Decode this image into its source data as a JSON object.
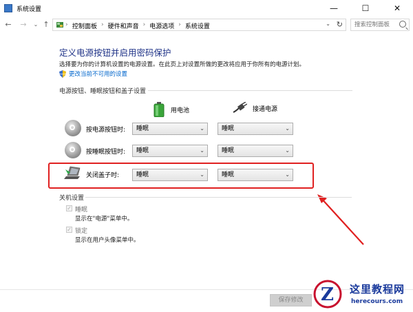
{
  "window": {
    "title": "系统设置",
    "controls": {
      "minimize": "—",
      "maximize": "☐",
      "close": "✕"
    }
  },
  "nav": {
    "back": "←",
    "forward": "→",
    "recent": "⌄",
    "up": "↑"
  },
  "address": {
    "crumbs": [
      "控制面板",
      "硬件和声音",
      "电源选项",
      "系统设置"
    ],
    "separator": "›",
    "dropdown": "⌄",
    "refresh": "↻"
  },
  "search": {
    "placeholder": "搜索控制面板"
  },
  "header": {
    "title": "定义电源按钮并启用密码保护",
    "description": "选择要为你的计算机设置的电源设置。在此页上对设置所做的更改将应用于你所有的电源计划。",
    "change_link": "更改当前不可用的设置"
  },
  "power_section": {
    "title": "电源按钮、睡眠按钮和盖子设置",
    "col_battery": "用电池",
    "col_plugged": "接通电源",
    "rows": [
      {
        "label": "按电源按钮时:",
        "battery": "睡眠",
        "plugged": "睡眠"
      },
      {
        "label": "按睡眠按钮时:",
        "battery": "睡眠",
        "plugged": "睡眠"
      },
      {
        "label": "关闭盖子时:",
        "battery": "睡眠",
        "plugged": "睡眠"
      }
    ],
    "chevron": "⌄"
  },
  "shutdown_section": {
    "title": "关机设置",
    "items": [
      {
        "label": "睡眠",
        "sub": "显示在\"电源\"菜单中。",
        "checked": true
      },
      {
        "label": "锁定",
        "sub": "显示在用户头像菜单中。",
        "checked": true
      }
    ],
    "checkmark": "✓"
  },
  "footer": {
    "save": "保存修改"
  },
  "watermark": {
    "title": "这里教程网",
    "url": "herecours.com"
  },
  "colors": {
    "title_blue": "#1e3287",
    "link_blue": "#0066cc",
    "highlight_red": "#e02020"
  }
}
